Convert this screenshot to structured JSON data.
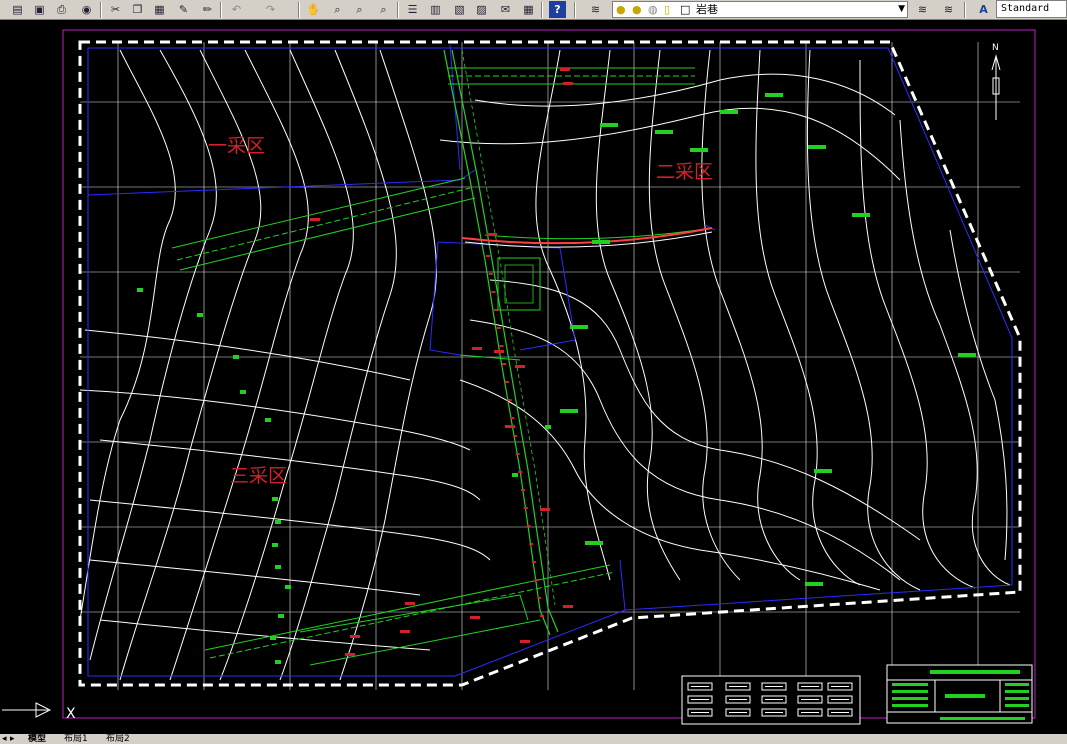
{
  "toolbar": {
    "layer_name": "岩巷",
    "text_style": "Standard",
    "buttons": [
      "open-icon",
      "save-icon",
      "print-icon",
      "publish-icon",
      "cut-icon",
      "copy-icon",
      "paste-icon",
      "match-properties-icon",
      "brush-icon",
      "undo-icon",
      "redo-icon",
      "pan-icon",
      "zoom-realtime-icon",
      "zoom-window-icon",
      "zoom-previous-icon",
      "properties-icon",
      "design-center-icon",
      "tool-palettes-icon",
      "sheet-set-icon",
      "markup-icon",
      "calculator-icon",
      "help-icon"
    ]
  },
  "drawing": {
    "zone_labels": [
      "三采区",
      "二采区",
      "一采区"
    ],
    "north_label": "N",
    "accent_color": "#d4202a",
    "contour_color": "#ffffff",
    "boundary_color": "#2b2bff",
    "roadway_color": "#22d022",
    "frame_color": "#c020c0"
  },
  "tabs": {
    "model": "模型",
    "layout1": "布局1",
    "layout2": "布局2"
  }
}
